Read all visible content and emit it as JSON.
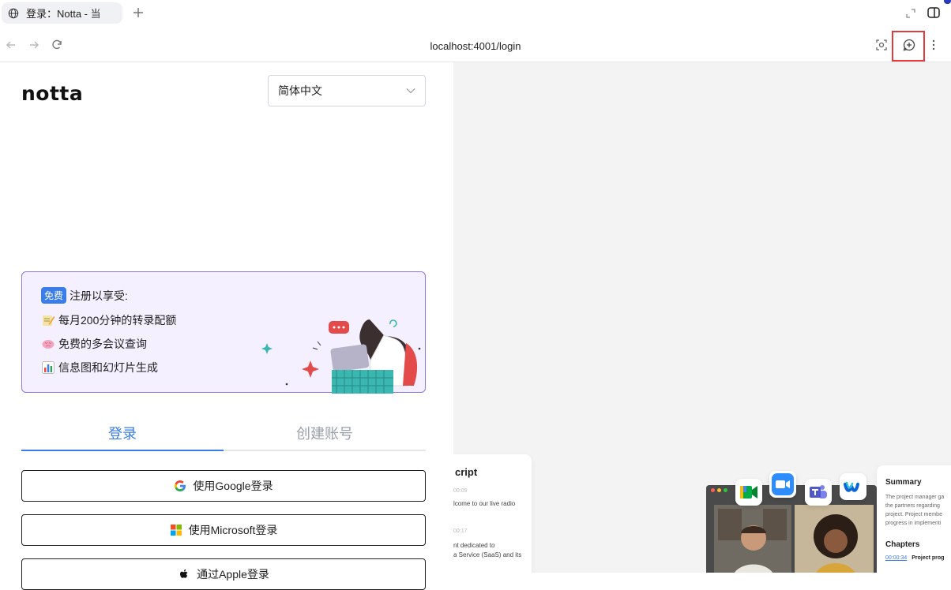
{
  "browser": {
    "tab_title": "登录：Notta - 当",
    "url": "localhost:4001/login"
  },
  "login": {
    "logo": "notta",
    "language": "简体中文",
    "promo": {
      "badge": "免费",
      "heading": "注册以享受:",
      "items": [
        {
          "icon": "memo-emoji-icon",
          "text": "每月200分钟的转录配额"
        },
        {
          "icon": "brain-emoji-icon",
          "text": "免费的多会议查询"
        },
        {
          "icon": "bar-chart-emoji-icon",
          "text": "信息图和幻灯片生成"
        }
      ]
    },
    "tabs": {
      "login": "登录",
      "signup": "创建账号"
    },
    "buttons": {
      "google": "使用Google登录",
      "microsoft": "使用Microsoft登录",
      "apple": "通过Apple登录"
    }
  },
  "preview": {
    "transcript": {
      "title": "cript",
      "lines": [
        {
          "time": "00:09",
          "text": "lcome to our live radio"
        },
        {
          "time": "00:17",
          "text": "nt dedicated to"
        },
        {
          "time": "",
          "text": "a Service (SaaS) and its"
        }
      ]
    },
    "summary": {
      "title": "Summary",
      "lines": [
        "The project manager ga",
        "the partners regarding",
        "project. Project membe",
        "progress in implementi"
      ],
      "chapters_title": "Chapters",
      "chapter_time": "00:00:34",
      "chapter_text": "Project prog"
    }
  },
  "colors": {
    "accent": "#3a7de8",
    "promo_bg": "#f5f0ff",
    "promo_border": "#8b7ae0",
    "highlight": "#e33b3b"
  }
}
